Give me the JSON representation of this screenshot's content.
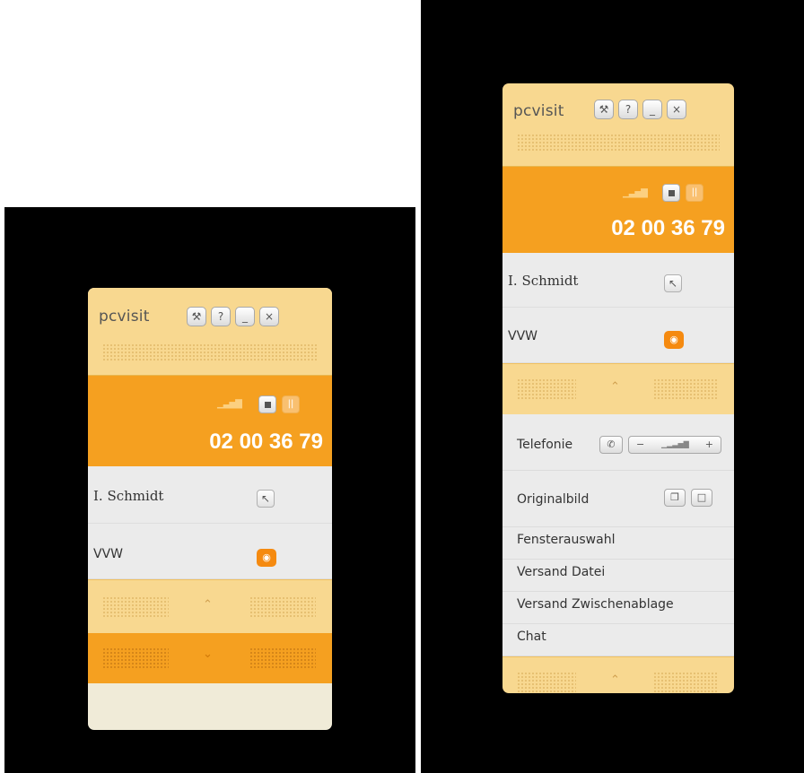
{
  "left_widget": {
    "logo": "pcvisit",
    "header_buttons": [
      {
        "icon": "wrench-icon",
        "glyph": "⚒"
      },
      {
        "icon": "help-icon",
        "glyph": "?"
      },
      {
        "icon": "minimize-icon",
        "glyph": "_"
      },
      {
        "icon": "close-icon",
        "glyph": "×"
      }
    ],
    "phone_number": "02 00 36 79",
    "user_name": "I.  Schmidt",
    "session_label": "VVW",
    "expand_up": "⌃",
    "expand_down": "⌄"
  },
  "right_widget": {
    "logo": "pcvisit",
    "header_buttons": [
      {
        "icon": "wrench-icon",
        "glyph": "⚒"
      },
      {
        "icon": "help-icon",
        "glyph": "?"
      },
      {
        "icon": "minimize-icon",
        "glyph": "_"
      },
      {
        "icon": "close-icon",
        "glyph": "×"
      }
    ],
    "phone_number": "02 00 36 79",
    "user_name": "I.  Schmidt",
    "session_label": "VVW",
    "collapse_up": "⌃",
    "menu": {
      "telefonie": "Telefonie",
      "volume_minus": "−",
      "volume_plus": "+",
      "originalbild": "Originalbild",
      "fensterauswahl": "Fensterauswahl",
      "versand_datei": "Versand Datei",
      "versand_zwischenablage": "Versand Zwischenablage",
      "chat": "Chat"
    },
    "collapse_up_bottom": "⌃"
  },
  "colors": {
    "accent_orange": "#f5a020",
    "light_yellow": "#f8d890",
    "gray_row": "#ebebeb"
  }
}
